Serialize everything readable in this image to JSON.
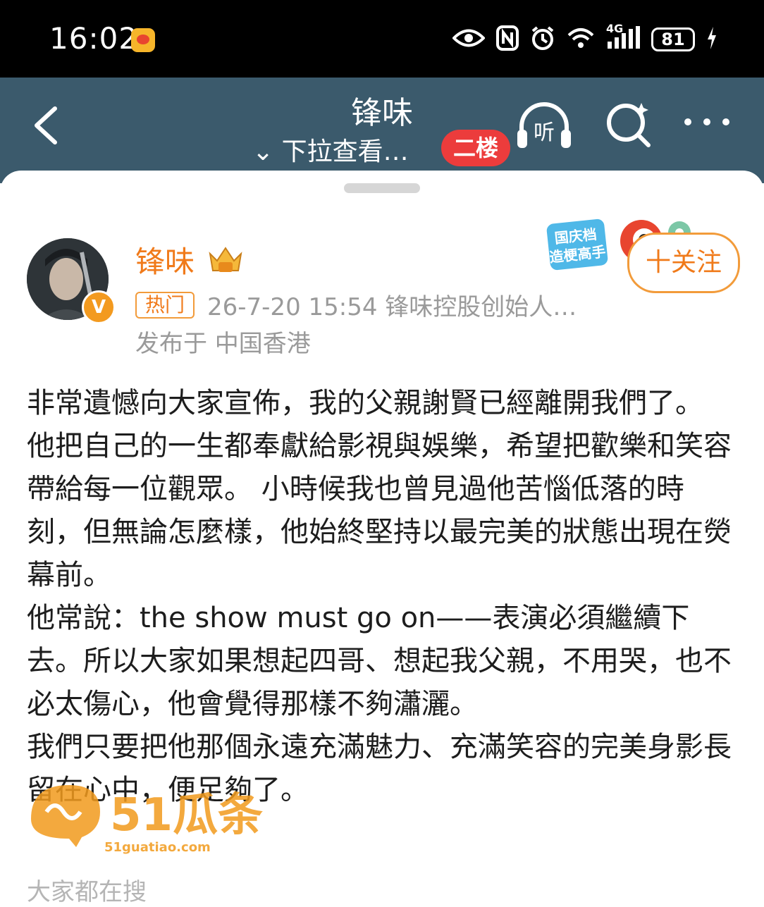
{
  "status_bar": {
    "time": "16:02",
    "network": "4G",
    "battery": "81",
    "icons": [
      "eye-comfort-icon",
      "nfc-icon",
      "alarm-icon",
      "wifi-icon",
      "signal-icon",
      "battery-icon",
      "charging-icon"
    ]
  },
  "header": {
    "title": "锋味",
    "subtitle": "⌄ 下拉查看…",
    "pill": "二楼",
    "listen_label": "听",
    "bg_color": "#3b5a6c"
  },
  "post": {
    "author": {
      "name": "锋味",
      "verified_badge": "V"
    },
    "tag": "热门",
    "meta_line": "26-7-20 15:54  锋味控股创始人…",
    "location": "发布于 中国香港",
    "promo_badge": {
      "line1": "国庆档",
      "line2": "造梗高手"
    },
    "follow_label": "十关注",
    "paragraphs": [
      "非常遺憾向大家宣佈，我的父親謝賢已經離開我們了。",
      "他把自己的一生都奉獻給影視與娛樂，希望把歡樂和笑容帶給每一位觀眾。 小時候我也曾見過他苦惱低落的時刻，但無論怎麼樣，他始終堅持以最完美的狀態出現在熒幕前。",
      "他常說：the show must go on——表演必須繼續下去。所以大家如果想起四哥、想起我父親，不用哭，也不必太傷心，他會覺得那樣不夠瀟灑。",
      "我們只要把他那個永遠充滿魅力、充滿笑容的完美身影長留在心中，便足夠了。"
    ],
    "cut_off_text": "大家都在搜"
  },
  "watermark": {
    "brand": "51瓜条",
    "url": "51guatiao.com"
  },
  "colors": {
    "accent": "#f07a1a",
    "pill_red": "#ec3c3c"
  }
}
